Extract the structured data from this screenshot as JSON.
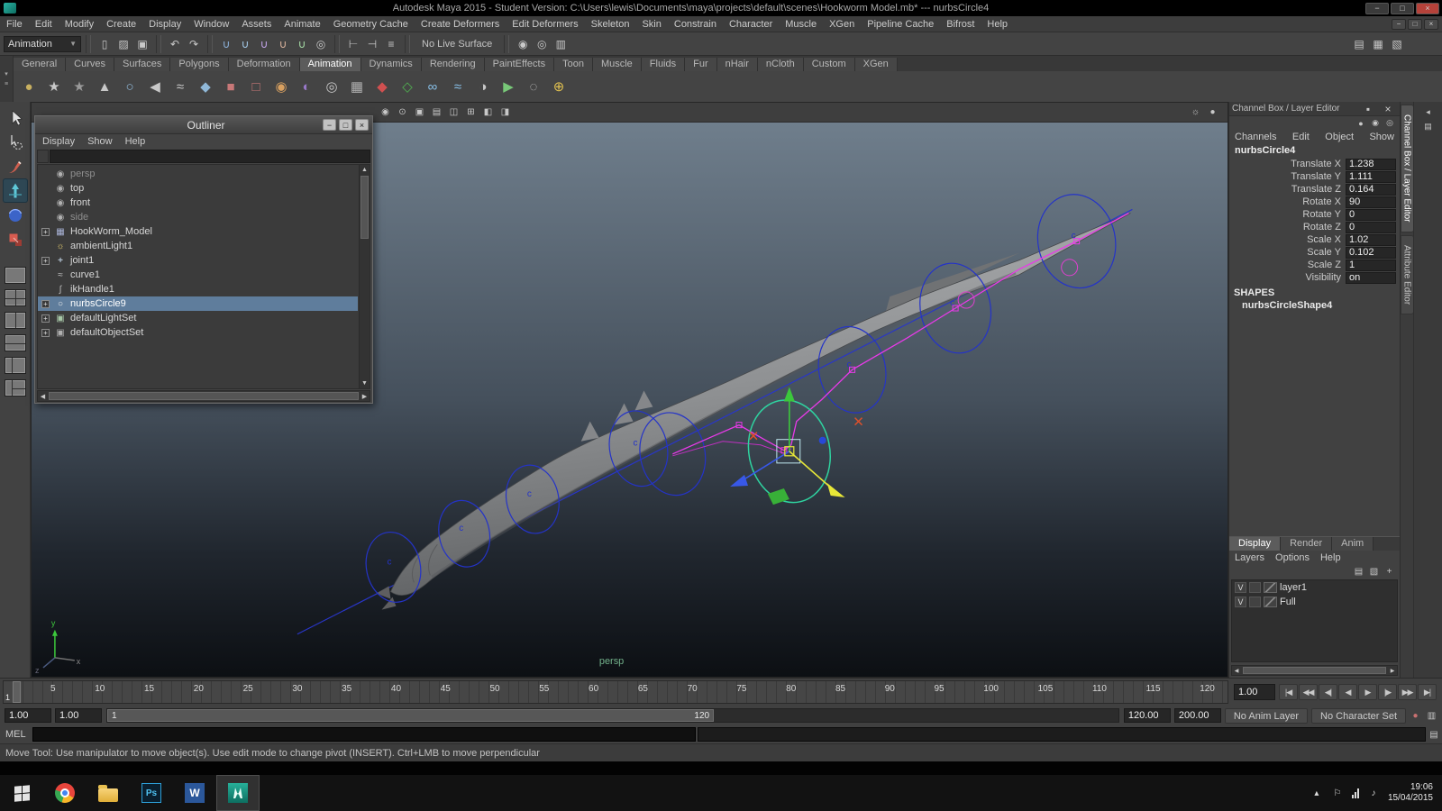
{
  "window": {
    "title": "Autodesk Maya 2015 - Student Version: C:\\Users\\lewis\\Documents\\maya\\projects\\default\\scenes\\Hookworm Model.mb*   ---   nurbsCircle4",
    "controls": [
      {
        "name": "minimize-button",
        "glyph": "−"
      },
      {
        "name": "maximize-button",
        "glyph": "□"
      },
      {
        "name": "close-button",
        "glyph": "×"
      }
    ]
  },
  "menu_bar": {
    "items": [
      "File",
      "Edit",
      "Modify",
      "Create",
      "Display",
      "Window",
      "Assets",
      "Animate",
      "Geometry Cache",
      "Create Deformers",
      "Edit Deformers",
      "Skeleton",
      "Skin",
      "Constrain",
      "Character",
      "Muscle",
      "XGen",
      "Pipeline Cache",
      "Bifrost",
      "Help"
    ]
  },
  "status_line": {
    "menu_set": "Animation",
    "no_live_surface": "No Live Surface",
    "file_icons": [
      {
        "name": "new-scene-icon",
        "glyph": "▯"
      },
      {
        "name": "open-scene-icon",
        "glyph": "▨"
      },
      {
        "name": "save-scene-icon",
        "glyph": "▣"
      }
    ],
    "edit_icons": [
      {
        "name": "undo-icon",
        "glyph": "↶"
      },
      {
        "name": "redo-icon",
        "glyph": "↷"
      }
    ],
    "snap_icons": [
      {
        "name": "snap-grid-icon",
        "glyph": "∪",
        "color": "#8fb6e0"
      },
      {
        "name": "snap-curve-icon",
        "glyph": "∪",
        "color": "#a8d0f0"
      },
      {
        "name": "snap-point-icon",
        "glyph": "∪",
        "color": "#c8a8f0"
      },
      {
        "name": "snap-plane-icon",
        "glyph": "∪",
        "color": "#e0b8a0"
      },
      {
        "name": "snap-view-icon",
        "glyph": "∪",
        "color": "#a8e0a8"
      },
      {
        "name": "make-live-icon",
        "glyph": "◎",
        "color": "#c8c8c8"
      }
    ],
    "history_icons": [
      {
        "name": "input-connections-icon",
        "glyph": "⊢"
      },
      {
        "name": "output-connections-icon",
        "glyph": "⊣"
      },
      {
        "name": "construction-history-icon",
        "glyph": "≡"
      }
    ],
    "render_icons": [
      {
        "name": "render-current-frame-icon",
        "glyph": "◉"
      },
      {
        "name": "ipr-render-icon",
        "glyph": "◎"
      },
      {
        "name": "render-settings-icon",
        "glyph": "▥"
      }
    ],
    "sidebar_icons": [
      {
        "name": "show-channel-box-icon",
        "glyph": "▤"
      },
      {
        "name": "show-layer-editor-icon",
        "glyph": "▦"
      },
      {
        "name": "show-attribute-editor-icon",
        "glyph": "▧"
      }
    ]
  },
  "shelf": {
    "tabs": [
      "General",
      "Curves",
      "Surfaces",
      "Polygons",
      "Deformation",
      "Animation",
      "Dynamics",
      "Rendering",
      "PaintEffects",
      "Toon",
      "Muscle",
      "Fluids",
      "Fur",
      "nHair",
      "nCloth",
      "Custom",
      "XGen"
    ],
    "active_tab": "Animation",
    "switcher_icons": [
      {
        "name": "shelf-tab-switcher-icon",
        "glyph": "▾"
      },
      {
        "name": "shelf-menu-icon",
        "glyph": "≡"
      }
    ],
    "icons": [
      {
        "name": "select-character-icon",
        "glyph": "●",
        "color": "#c8b060"
      },
      {
        "name": "walk-tool-icon",
        "glyph": "★",
        "color": "#c8c8c8"
      },
      {
        "name": "run-tool-icon",
        "glyph": "★",
        "color": "#9a9a9a"
      },
      {
        "name": "pose-icon",
        "glyph": "▲",
        "color": "#c8c8c8"
      },
      {
        "name": "joint-tool-icon",
        "glyph": "○",
        "color": "#90b8d8"
      },
      {
        "name": "ik-handle-icon",
        "glyph": "◀",
        "color": "#c8c8c8"
      },
      {
        "name": "ik-spline-icon",
        "glyph": "≈",
        "color": "#c8c8c8"
      },
      {
        "name": "skeleton-chain-icon",
        "glyph": "◆",
        "color": "#90b8d8"
      },
      {
        "name": "bind-skin-icon",
        "glyph": "■",
        "color": "#c87878"
      },
      {
        "name": "detach-skin-icon",
        "glyph": "□",
        "color": "#c87878"
      },
      {
        "name": "paint-weights-icon",
        "glyph": "◉",
        "color": "#d8a060"
      },
      {
        "name": "blend-shape-icon",
        "glyph": "◐",
        "color": "#9878c8"
      },
      {
        "name": "cluster-icon",
        "glyph": "◎",
        "color": "#c8c8c8"
      },
      {
        "name": "lattice-icon",
        "glyph": "▦",
        "color": "#b0b0b0"
      },
      {
        "name": "set-key-icon",
        "glyph": "◆",
        "color": "#d05050"
      },
      {
        "name": "set-breakdown-icon",
        "glyph": "◇",
        "color": "#50b050"
      },
      {
        "name": "motion-path-icon",
        "glyph": "∞",
        "color": "#88c0e8"
      },
      {
        "name": "motion-trail-icon",
        "glyph": "≈",
        "color": "#88c0e8"
      },
      {
        "name": "turntable-icon",
        "glyph": "◑",
        "color": "#c8c8c8"
      },
      {
        "name": "playblast-icon",
        "glyph": "▶",
        "color": "#78c878"
      },
      {
        "name": "ghost-icon",
        "glyph": "◌",
        "color": "#c8c8c8"
      },
      {
        "name": "bake-animation-icon",
        "glyph": "⊕",
        "color": "#e0c050"
      }
    ]
  },
  "toolbox": {
    "tools": [
      "select-tool",
      "lasso-select-tool",
      "paint-select-tool",
      "move-tool",
      "rotate-tool",
      "scale-tool"
    ],
    "active_tool": "move-tool"
  },
  "outliner": {
    "title": "Outliner",
    "menus": [
      "Display",
      "Show",
      "Help"
    ],
    "items": [
      {
        "label": "persp",
        "icon": "camera"
      },
      {
        "label": "top",
        "icon": "camera"
      },
      {
        "label": "front",
        "icon": "camera"
      },
      {
        "label": "side",
        "icon": "camera"
      },
      {
        "label": "HookWorm_Model",
        "icon": "polygon-mesh"
      },
      {
        "label": "ambientLight1",
        "icon": "ambient-light"
      },
      {
        "label": "joint1",
        "icon": "joint"
      },
      {
        "label": "curve1",
        "icon": "nurbs-curve"
      },
      {
        "label": "ikHandle1",
        "icon": "ik-handle"
      },
      {
        "label": "nurbsCircle9",
        "icon": "nurbs-circle"
      },
      {
        "label": "defaultLightSet",
        "icon": "object-set"
      },
      {
        "label": "defaultObjectSet",
        "icon": "object-set"
      }
    ]
  },
  "viewport": {
    "camera_label": "persp",
    "curve_label": "c",
    "toolbar_icons": [
      {
        "name": "viewport-camera-icon",
        "glyph": "◉"
      },
      {
        "name": "lock-camera-icon",
        "glyph": "⊙"
      },
      {
        "name": "camera-attributes-icon",
        "glyph": "▣"
      },
      {
        "name": "bookmarks-icon",
        "glyph": "▤"
      },
      {
        "name": "image-plane-icon",
        "glyph": "◫"
      },
      {
        "name": "view-grid-icon",
        "glyph": "⊞"
      },
      {
        "name": "film-gate-icon",
        "glyph": "◧"
      },
      {
        "name": "gate-mask-icon",
        "glyph": "◨"
      }
    ],
    "toolbar_right_icons": [
      {
        "name": "lighting-icon",
        "glyph": "☼"
      },
      {
        "name": "shading-icon",
        "glyph": "●"
      }
    ]
  },
  "channel_box": {
    "header": "Channel Box / Layer Editor",
    "header_icons": [
      {
        "name": "pin-icon",
        "glyph": "▪"
      },
      {
        "name": "close-icon",
        "glyph": "×"
      }
    ],
    "speed_icons": [
      {
        "name": "manip-default-icon",
        "glyph": "●"
      },
      {
        "name": "manip-speed-icon",
        "glyph": "◉"
      },
      {
        "name": "manip-hyperbolic-icon",
        "glyph": "◎"
      }
    ],
    "menus": [
      "Channels",
      "Edit",
      "Object",
      "Show"
    ],
    "object_name": "nurbsCircle4",
    "channels": [
      {
        "label": "Translate X",
        "value": "1.238"
      },
      {
        "label": "Translate Y",
        "value": "1.111"
      },
      {
        "label": "Translate Z",
        "value": "0.164"
      },
      {
        "label": "Rotate X",
        "value": "90"
      },
      {
        "label": "Rotate Y",
        "value": "0"
      },
      {
        "label": "Rotate Z",
        "value": "0"
      },
      {
        "label": "Scale X",
        "value": "1.02"
      },
      {
        "label": "Scale Y",
        "value": "0.102"
      },
      {
        "label": "Scale Z",
        "value": "1"
      },
      {
        "label": "Visibility",
        "value": "on"
      }
    ],
    "shapes_label": "SHAPES",
    "shape_name": "nurbsCircleShape4"
  },
  "layer_editor": {
    "tabs": [
      "Display",
      "Render",
      "Anim"
    ],
    "active_tab": "Display",
    "menus": [
      "Layers",
      "Options",
      "Help"
    ],
    "icons": [
      {
        "name": "select-layer-objects-icon",
        "glyph": "▤"
      },
      {
        "name": "new-empty-layer-icon",
        "glyph": "▧"
      },
      {
        "name": "new-layer-from-selected-icon",
        "glyph": "+"
      }
    ],
    "layers": [
      {
        "visibility": "V",
        "name": "layer1"
      },
      {
        "visibility": "V",
        "name": "Full"
      }
    ]
  },
  "right_dock": {
    "tabs": [
      "Channel Box / Layer Editor",
      "Attribute Editor"
    ],
    "dock_icons": [
      {
        "name": "dock-expand-icon",
        "glyph": "◂"
      },
      {
        "name": "dock-options-icon",
        "glyph": "▤"
      }
    ]
  },
  "timeline": {
    "ticks": [
      "5",
      "10",
      "15",
      "20",
      "25",
      "30",
      "35",
      "40",
      "45",
      "50",
      "55",
      "60",
      "65",
      "70",
      "75",
      "80",
      "85",
      "90",
      "95",
      "100",
      "105",
      "110",
      "115",
      "120"
    ],
    "current_frame": "1",
    "current_time_field": "1.00",
    "playback_icons": [
      {
        "name": "go-to-start-button",
        "glyph": "|◀"
      },
      {
        "name": "step-back-frame-button",
        "glyph": "◀◀"
      },
      {
        "name": "step-back-key-button",
        "glyph": "◀|"
      },
      {
        "name": "play-backwards-button",
        "glyph": "◀"
      },
      {
        "name": "play-forwards-button",
        "glyph": "▶"
      },
      {
        "name": "step-forward-key-button",
        "glyph": "|▶"
      },
      {
        "name": "step-forward-frame-button",
        "glyph": "▶▶"
      },
      {
        "name": "go-to-end-button",
        "glyph": "▶|"
      }
    ]
  },
  "range_slider": {
    "anim_start": "1.00",
    "playback_start": "1.00",
    "bar_start_label": "1",
    "bar_end_label": "120",
    "playback_end": "120.00",
    "anim_end": "200.00",
    "anim_layer_button": "No Anim Layer",
    "character_set_button": "No Character Set",
    "right_icons": [
      {
        "name": "auto-keyframe-icon",
        "glyph": "●",
        "color": "#c87070"
      },
      {
        "name": "animation-preferences-icon",
        "glyph": "▥"
      }
    ]
  },
  "command_line": {
    "label": "MEL",
    "right_icons": [
      {
        "name": "script-editor-icon",
        "glyph": "▤"
      }
    ]
  },
  "help_line": {
    "text": "Move Tool: Use manipulator to move object(s). Use edit mode to change pivot (INSERT).  Ctrl+LMB to move perpendicular"
  },
  "taskbar": {
    "photoshop_label": "Ps",
    "word_label": "W",
    "clock_time": "19:06",
    "clock_date": "15/04/2015"
  }
}
